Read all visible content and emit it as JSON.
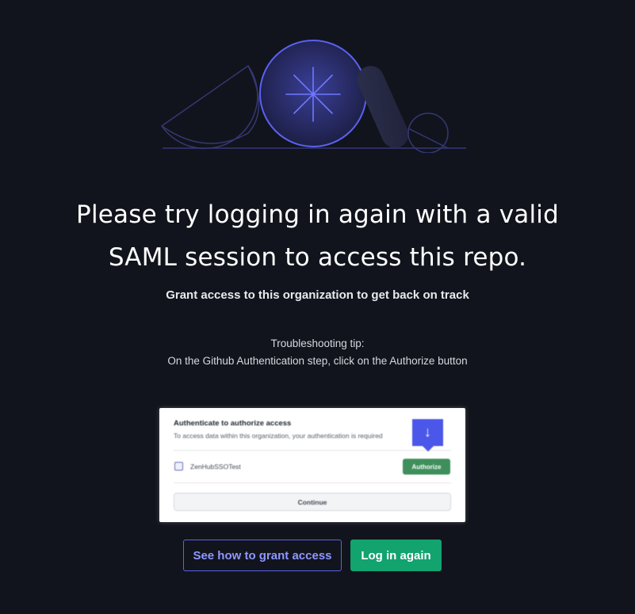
{
  "headline": {
    "line1": "Please try logging in again with a valid",
    "line2": "SAML session to access this repo."
  },
  "subtitle": "Grant access to this organization to get back on track",
  "tip": {
    "label": "Troubleshooting tip:",
    "text": "On the Github Authentication step, click on the Authorize button"
  },
  "screenshot": {
    "title": "Authenticate to authorize access",
    "description": "To access data within this organization, your authentication is required",
    "org_name": "ZenHubSSOTest",
    "authorize_label": "Authorize",
    "continue_label": "Continue",
    "pointer_icon": "arrow-down-icon"
  },
  "buttons": {
    "grant_access_label": "See how to grant access",
    "login_label": "Log in again"
  },
  "colors": {
    "background": "#11141c",
    "accent": "#5a63e8",
    "primary": "#12a36f"
  }
}
